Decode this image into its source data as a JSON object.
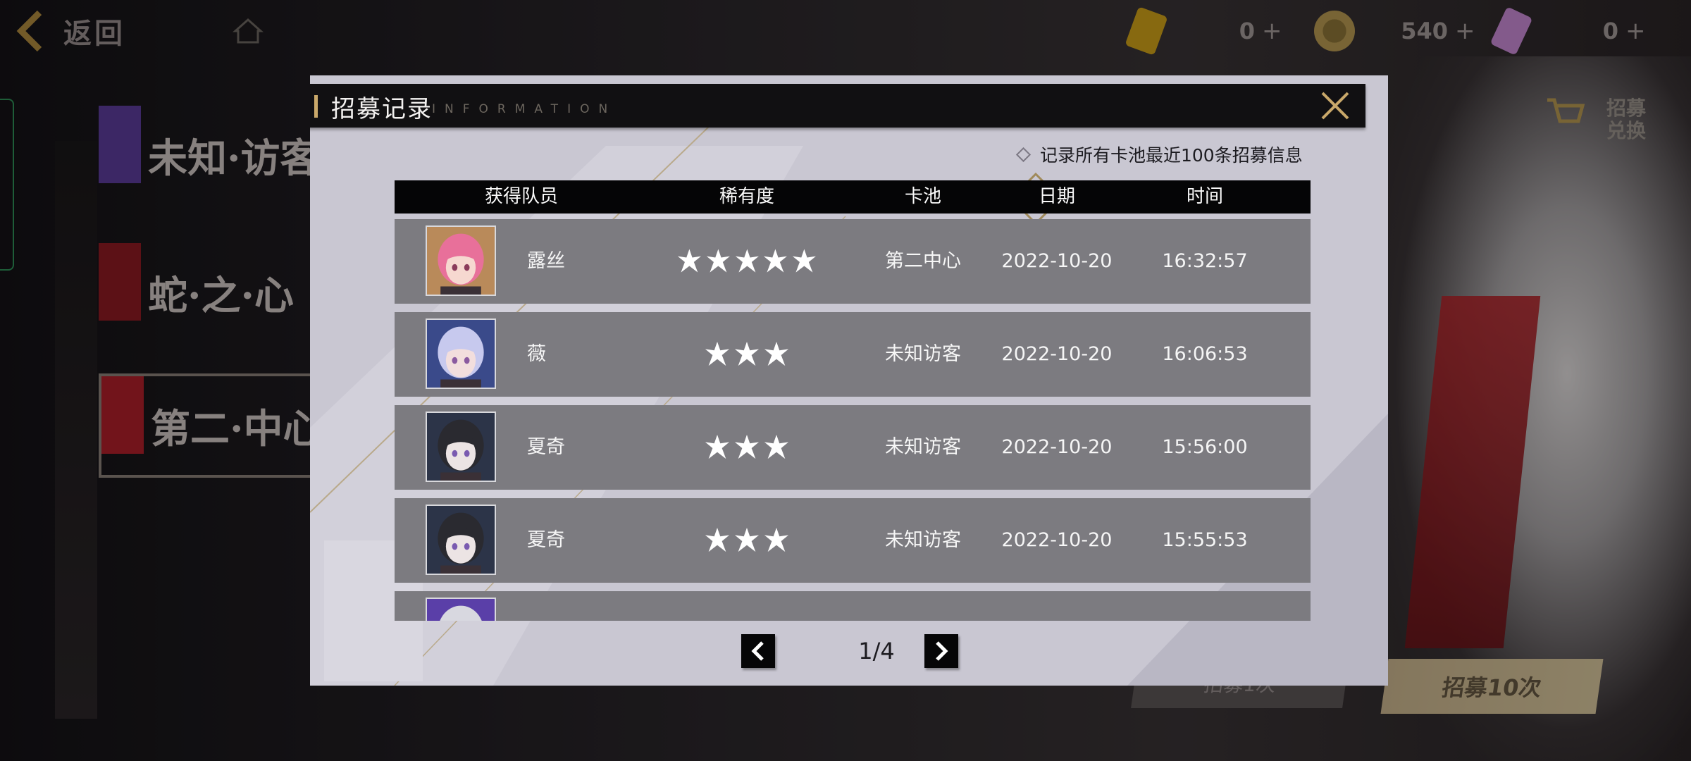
{
  "background": {
    "back_label": "返回",
    "resources": [
      {
        "icon": "gold-ticket-icon",
        "value": "0",
        "color": "#d0a21a"
      },
      {
        "icon": "coin-icon",
        "value": "540",
        "color": "#b89a52"
      },
      {
        "icon": "purple-ticket-icon",
        "value": "0",
        "color": "#c98ad6"
      }
    ],
    "banners": [
      "未知·访客",
      "蛇·之·心",
      "第二·中心"
    ],
    "shop_label": "招募兑换",
    "recruit_1_label": "招募1次",
    "recruit_10_label": "招募10次"
  },
  "dialog": {
    "title": "招募记录",
    "subtitle": "INFORMATION",
    "note": "记录所有卡池最近100条招募信息",
    "columns": {
      "member": "获得队员",
      "rarity": "稀有度",
      "pool": "卡池",
      "date": "日期",
      "time": "时间"
    },
    "records": [
      {
        "name": "露丝",
        "rarity": 5,
        "pool": "第二中心",
        "date": "2022-10-20",
        "time": "16:32:57",
        "avatar": "pink"
      },
      {
        "name": "薇",
        "rarity": 3,
        "pool": "未知访客",
        "date": "2022-10-20",
        "time": "16:06:53",
        "avatar": "blue"
      },
      {
        "name": "夏奇",
        "rarity": 3,
        "pool": "未知访客",
        "date": "2022-10-20",
        "time": "15:56:00",
        "avatar": "grey"
      },
      {
        "name": "夏奇",
        "rarity": 3,
        "pool": "未知访客",
        "date": "2022-10-20",
        "time": "15:55:53",
        "avatar": "grey"
      },
      {
        "name": "",
        "rarity": 0,
        "pool": "",
        "date": "",
        "time": "",
        "avatar": "purple"
      }
    ],
    "page_label": "1/4"
  },
  "colors": {
    "dialog_bg": "#c9c7d2",
    "row_bg": "#7c7b80",
    "header_bg": "#050506",
    "accent": "#c9a86a"
  }
}
